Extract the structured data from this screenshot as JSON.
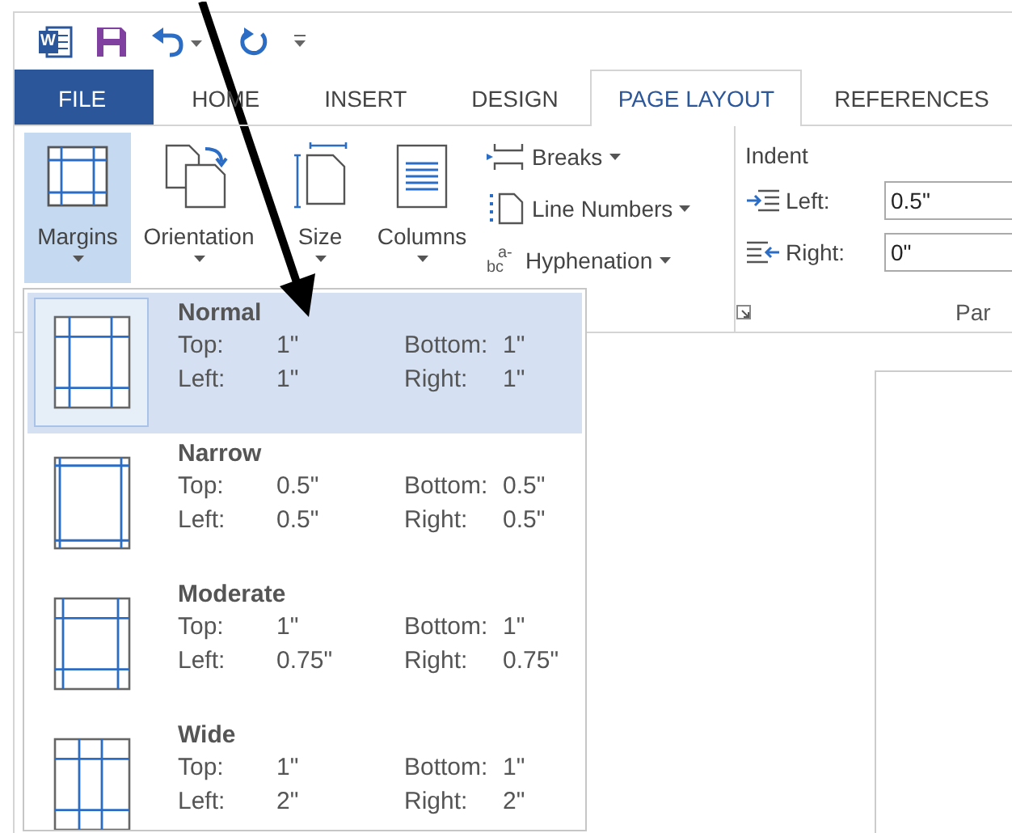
{
  "quick_access": {
    "app_icon_letter": "W"
  },
  "tabs": [
    {
      "label": "FILE",
      "kind": "file",
      "selected": false
    },
    {
      "label": "HOME",
      "kind": "tab",
      "selected": false
    },
    {
      "label": "INSERT",
      "kind": "tab",
      "selected": false
    },
    {
      "label": "DESIGN",
      "kind": "tab",
      "selected": false
    },
    {
      "label": "PAGE LAYOUT",
      "kind": "tab",
      "selected": true
    },
    {
      "label": "REFERENCES",
      "kind": "tab",
      "selected": false
    }
  ],
  "ribbon": {
    "large_buttons": [
      {
        "label": "Margins",
        "kind": "margins",
        "active": true
      },
      {
        "label": "Orientation",
        "kind": "orientation",
        "active": false
      },
      {
        "label": "Size",
        "kind": "size",
        "active": false
      },
      {
        "label": "Columns",
        "kind": "columns",
        "active": false
      }
    ],
    "small_buttons": [
      {
        "label": "Breaks",
        "kind": "breaks"
      },
      {
        "label": "Line Numbers",
        "kind": "line-numbers"
      },
      {
        "label": "Hyphenation",
        "kind": "hyphenation",
        "icon_text": [
          "a-",
          "bc"
        ]
      }
    ],
    "indent": {
      "title": "Indent",
      "fields": [
        {
          "label": "Left:",
          "kind": "left",
          "value": "0.5\""
        },
        {
          "label": "Right:",
          "kind": "right",
          "value": "0\""
        }
      ]
    },
    "group_label": "Par"
  },
  "margins_menu": {
    "presets": [
      {
        "name": "Normal",
        "kind": "normal",
        "selected": true,
        "fields": [
          {
            "label": "Top:",
            "value": "1\""
          },
          {
            "label": "Bottom:",
            "value": "1\""
          },
          {
            "label": "Left:",
            "value": "1\""
          },
          {
            "label": "Right:",
            "value": "1\""
          }
        ]
      },
      {
        "name": "Narrow",
        "kind": "narrow",
        "selected": false,
        "fields": [
          {
            "label": "Top:",
            "value": "0.5\""
          },
          {
            "label": "Bottom:",
            "value": "0.5\""
          },
          {
            "label": "Left:",
            "value": "0.5\""
          },
          {
            "label": "Right:",
            "value": "0.5\""
          }
        ]
      },
      {
        "name": "Moderate",
        "kind": "moderate",
        "selected": false,
        "fields": [
          {
            "label": "Top:",
            "value": "1\""
          },
          {
            "label": "Bottom:",
            "value": "1\""
          },
          {
            "label": "Left:",
            "value": "0.75\""
          },
          {
            "label": "Right:",
            "value": "0.75\""
          }
        ]
      },
      {
        "name": "Wide",
        "kind": "wide",
        "selected": false,
        "fields": [
          {
            "label": "Top:",
            "value": "1\""
          },
          {
            "label": "Bottom:",
            "value": "1\""
          },
          {
            "label": "Left:",
            "value": "2\""
          },
          {
            "label": "Right:",
            "value": "2\""
          }
        ]
      }
    ]
  }
}
